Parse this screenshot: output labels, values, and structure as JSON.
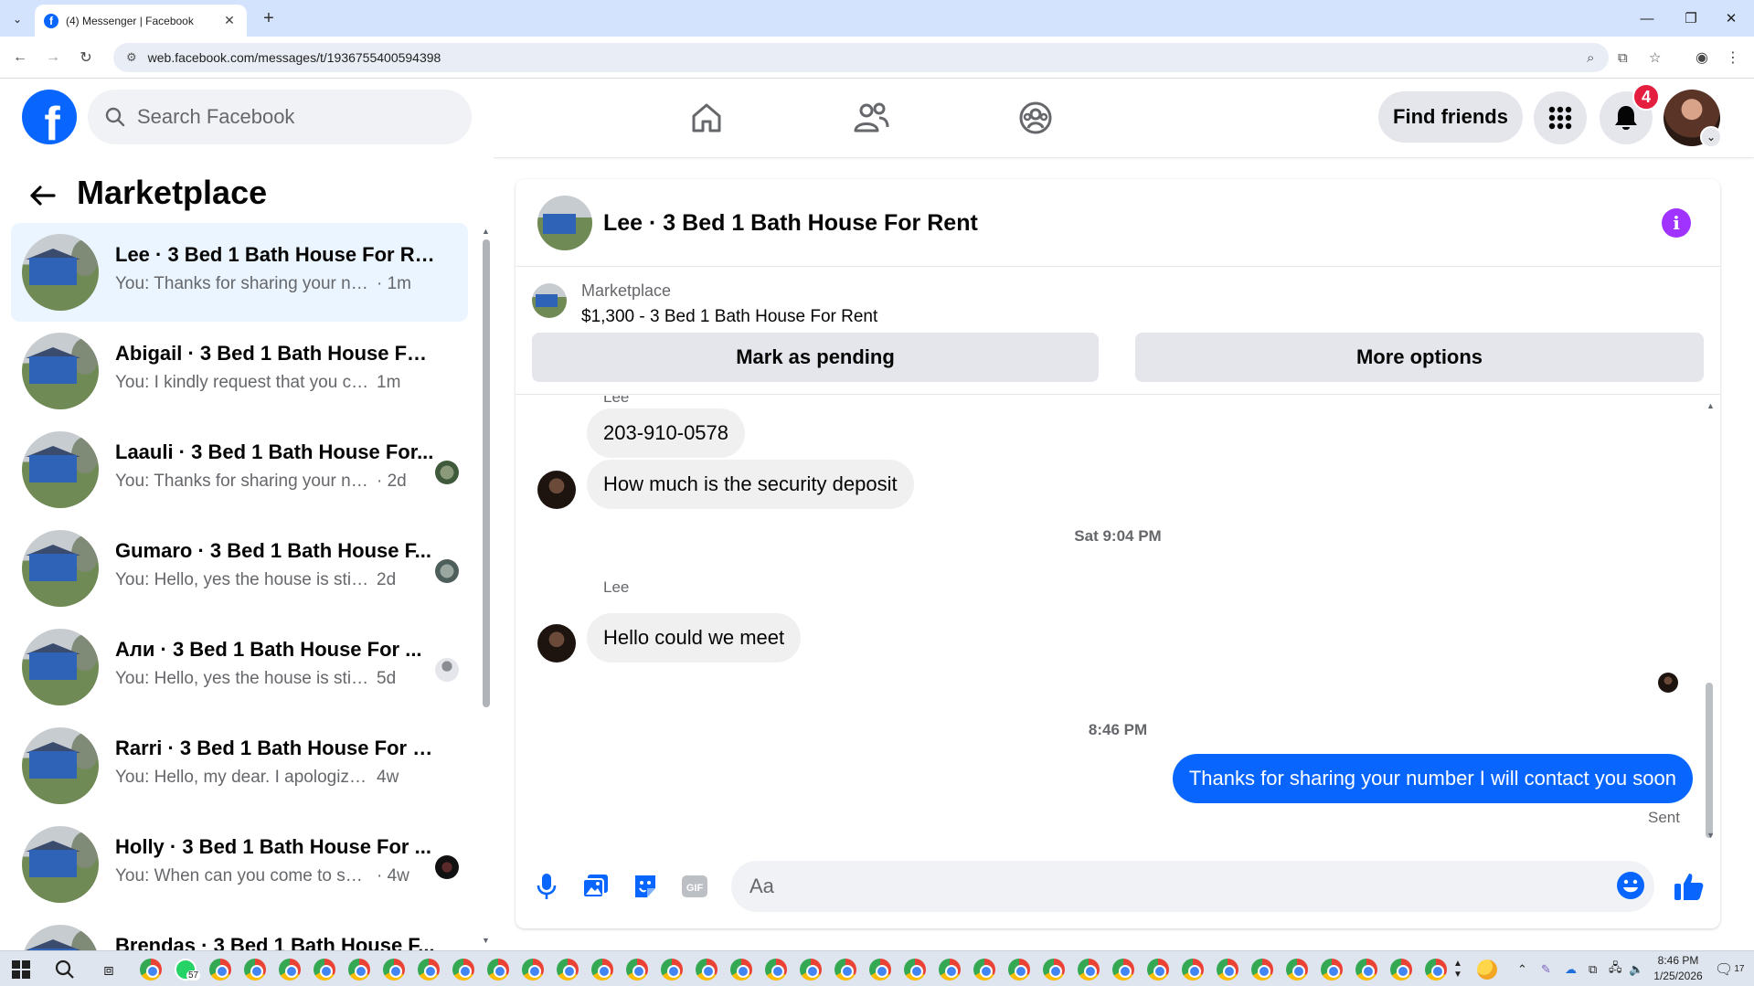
{
  "browser": {
    "tab_title": "(4) Messenger | Facebook",
    "url": "web.facebook.com/messages/t/1936755400594398"
  },
  "fb": {
    "search_placeholder": "Search Facebook",
    "find_friends": "Find friends",
    "notification_count": "4"
  },
  "sidebar": {
    "title": "Marketplace",
    "conversations": [
      {
        "title": "Lee · 3 Bed 1 Bath House For Rent",
        "preview": "You: Thanks for sharing your numb...",
        "time": "· 1m",
        "active": true
      },
      {
        "title": "Abigail · 3 Bed 1 Bath House For ...",
        "preview": "You: I kindly request that you compl...",
        "time": "1m",
        "active": false
      },
      {
        "title": "Laauli · 3 Bed 1 Bath House For...",
        "preview": "You: Thanks for sharing your num...",
        "time": "· 2d",
        "active": false
      },
      {
        "title": "Gumaro · 3 Bed 1 Bath House F...",
        "preview": "You: Hello, yes the house is still a...",
        "time": "2d",
        "active": false
      },
      {
        "title": "Али · 3 Bed 1 Bath House For ...",
        "preview": "You: Hello, yes the house is still a...",
        "time": "5d",
        "active": false
      },
      {
        "title": "Rarri · 3 Bed 1 Bath House For Rent",
        "preview": "You: Hello, my dear. I apologize for ...",
        "time": "4w",
        "active": false
      },
      {
        "title": "Holly · 3 Bed 1 Bath House For ...",
        "preview": "You: When can you come to see ...",
        "time": "· 4w",
        "active": false
      },
      {
        "title": "Brendas · 3 Bed 1 Bath House F...",
        "preview": "",
        "time": "",
        "active": false
      }
    ]
  },
  "chat": {
    "title": "Lee · 3 Bed 1 Bath House For Rent",
    "listing_source": "Marketplace",
    "listing_title": "$1,300 - 3 Bed 1 Bath House For Rent",
    "mark_pending": "Mark as pending",
    "more_options": "More options",
    "partial_sender": "Lee",
    "msg_phone": "203-910-0578",
    "msg_deposit": "How much is the security deposit",
    "timestamp_1": "Sat 9:04 PM",
    "sender_name": "Lee",
    "msg_meet": "Hello could we meet",
    "timestamp_2": "8:46 PM",
    "msg_out": "Thanks for sharing your number I will contact you soon",
    "sent_status": "Sent",
    "input_placeholder": "Aa"
  },
  "taskbar": {
    "whatsapp_badge": "57",
    "time": "8:46 PM",
    "date": "1/25/2026",
    "notif_count": "17"
  },
  "colors": {
    "fb_blue": "#0866ff",
    "active_conv": "#ebf5ff",
    "badge_red": "#e41e3f",
    "info_purple": "#a033ff"
  }
}
